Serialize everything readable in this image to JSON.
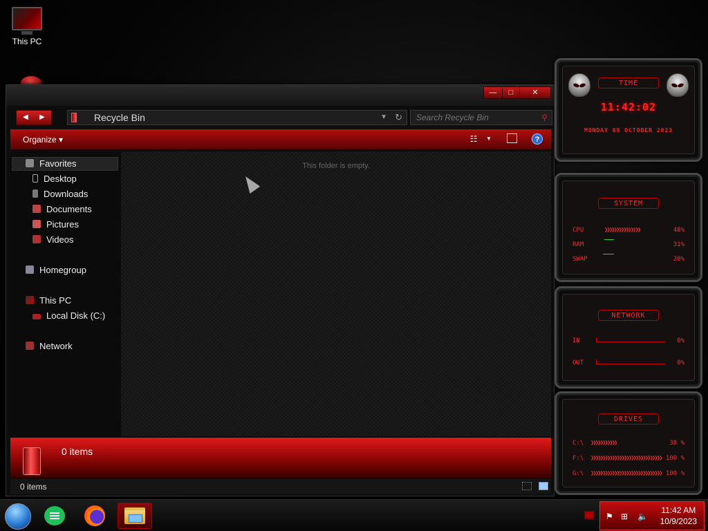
{
  "desktop": {
    "icons": [
      {
        "label": "This PC"
      }
    ]
  },
  "window": {
    "controls": {
      "minimize": "—",
      "maximize": "□",
      "close": "✕"
    },
    "address": {
      "path": "Recycle Bin"
    },
    "search": {
      "placeholder": "Search Recycle Bin"
    },
    "commandbar": {
      "organize_label": "Organize ▾"
    },
    "nav": {
      "favorites": "Favorites",
      "desktop": "Desktop",
      "downloads": "Downloads",
      "documents": "Documents",
      "pictures": "Pictures",
      "videos": "Videos",
      "homegroup": "Homegroup",
      "this_pc": "This PC",
      "local_disk": "Local Disk (C:)",
      "network": "Network"
    },
    "content": {
      "empty_message": "This folder is empty."
    },
    "details": {
      "count": "0 items"
    },
    "statusbar": {
      "count": "0 items"
    }
  },
  "gadgets": {
    "time": {
      "title": "TIME",
      "clock": "11:42:02",
      "date": "MONDAY 09 OCTOBER 2023"
    },
    "system": {
      "title": "SYSTEM",
      "rows": [
        {
          "label": "CPU",
          "value": "48%",
          "level": 0.48
        },
        {
          "label": "RAM",
          "value": "31%",
          "level": 0.31
        },
        {
          "label": "SWAP",
          "value": "20%",
          "level": 0.2
        }
      ]
    },
    "network": {
      "title": "NETWORK",
      "rows": [
        {
          "label": "IN",
          "value": "0%"
        },
        {
          "label": "OUT",
          "value": "0%"
        }
      ]
    },
    "drives": {
      "title": "DRIVES",
      "rows": [
        {
          "label": "C:\\",
          "value": "38 %",
          "level": 0.38
        },
        {
          "label": "F:\\",
          "value": "100 %",
          "level": 1.0
        },
        {
          "label": "G:\\",
          "value": "100 %",
          "level": 1.0
        }
      ]
    }
  },
  "taskbar": {
    "clock": {
      "time": "11:42 AM",
      "date": "10/9/2023"
    }
  },
  "colors": {
    "accent": "#c00000",
    "gadget_text": "#ff2a2a"
  }
}
